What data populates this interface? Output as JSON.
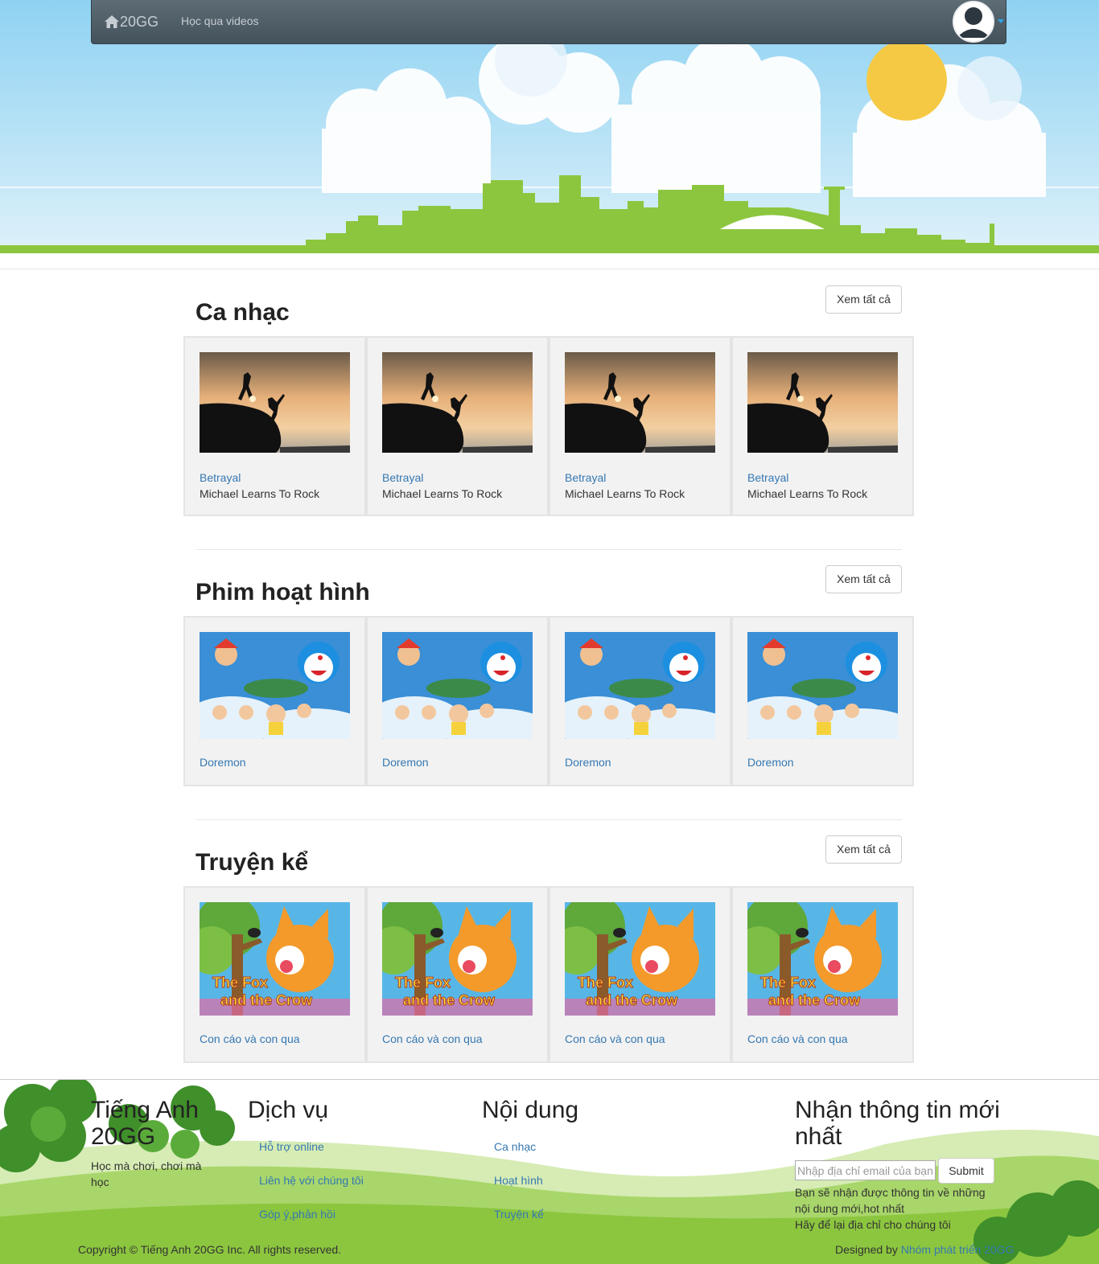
{
  "navbar": {
    "brand": "20GG",
    "link": "Học qua videos",
    "icons": [
      "home-icon",
      "user-avatar-icon",
      "caret-down-icon"
    ]
  },
  "colors": {
    "navbar": "#4e5d66",
    "link": "#3578b2",
    "grass": "#8cc63f",
    "sky": "#8fd2f2",
    "sun": "#f5c944"
  },
  "sections": [
    {
      "title": "Ca nhạc",
      "see_all": "Xem tất cả",
      "thumbnail": "sunset-silhouette-image",
      "cards": [
        {
          "title": "Betrayal",
          "artist": "Michael Learns To Rock"
        },
        {
          "title": "Betrayal",
          "artist": "Michael Learns To Rock"
        },
        {
          "title": "Betrayal",
          "artist": "Michael Learns To Rock"
        },
        {
          "title": "Betrayal",
          "artist": "Michael Learns To Rock"
        }
      ]
    },
    {
      "title": "Phim hoạt hình",
      "see_all": "Xem tất cả",
      "thumbnail": "doraemon-cartoon-image",
      "cards": [
        {
          "title": "Doremon"
        },
        {
          "title": "Doremon"
        },
        {
          "title": "Doremon"
        },
        {
          "title": "Doremon"
        }
      ]
    },
    {
      "title": "Truyện kể",
      "see_all": "Xem tất cả",
      "thumbnail": "fox-and-crow-image",
      "thumb_caption_1": "The Fox",
      "thumb_caption_2": "and the Crow",
      "cards": [
        {
          "title": "Con cáo và con qua"
        },
        {
          "title": "Con cáo và con qua"
        },
        {
          "title": "Con cáo và con qua"
        },
        {
          "title": "Con cáo và con qua"
        }
      ]
    }
  ],
  "footer": {
    "about": {
      "title_line1": "Tiếng Anh",
      "title_line2": "20GG",
      "tagline_line1": "Học mà chơi, chơi mà",
      "tagline_line2": "học"
    },
    "services": {
      "title": "Dịch vụ",
      "links": [
        "Hỗ trợ online",
        "Liên hệ với chúng tôi",
        "Góp ý,phản hồi"
      ]
    },
    "content": {
      "title": "Nội dung",
      "links": [
        "Ca nhạc",
        "Hoạt hình",
        "Truyện kể"
      ]
    },
    "newsletter": {
      "title_line1": "Nhận thông tin mới",
      "title_line2": "nhất",
      "placeholder": "Nhập địa chỉ email của bạn",
      "submit": "Submit",
      "note_line1": "Bạn sẽ nhận được thông tin về những",
      "note_line2": "nội dung mới,hot nhất",
      "note_line3": "Hãy để lại địa chỉ cho chúng tôi"
    },
    "copyright": "Copyright © Tiếng Anh 20GG Inc. All rights reserved.",
    "designed_prefix": "Designed by ",
    "designed_link": "Nhóm phát triển 20GG"
  }
}
